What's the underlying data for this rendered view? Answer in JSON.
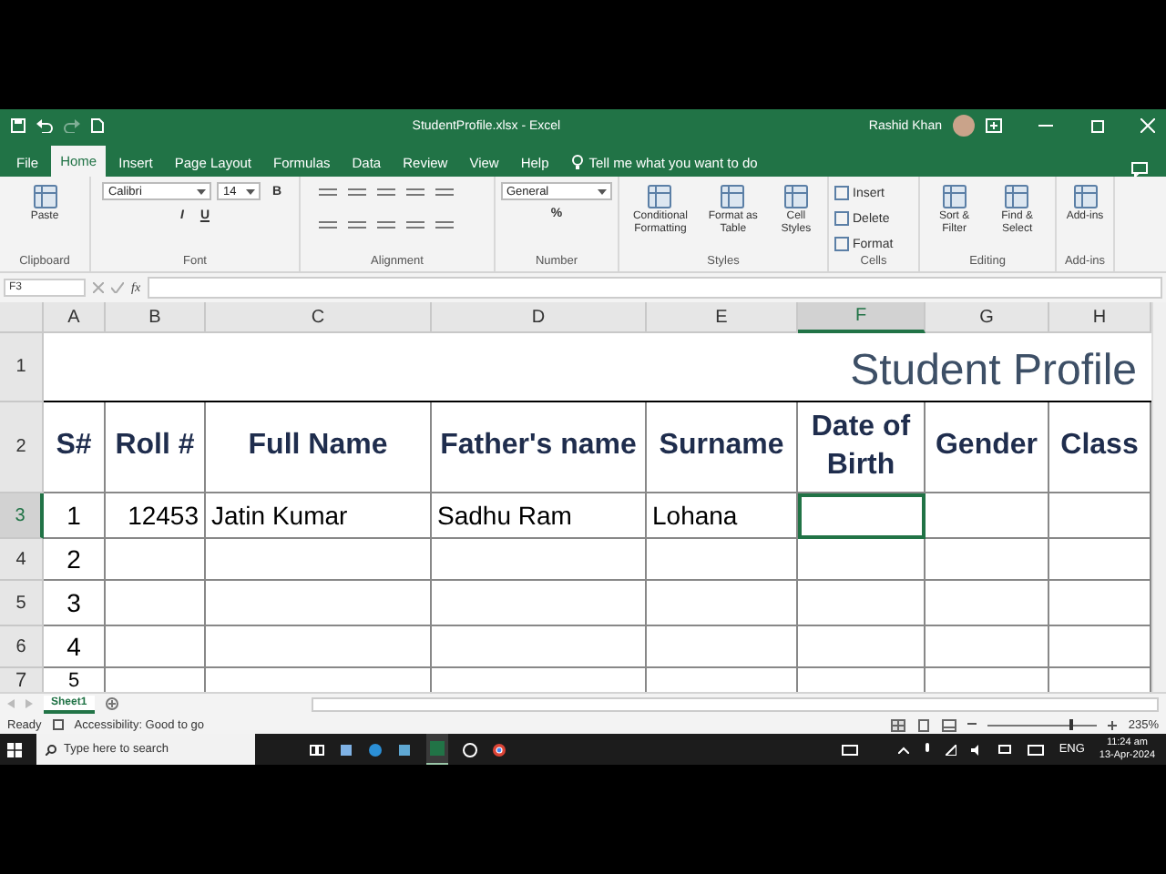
{
  "window": {
    "title": "StudentProfile.xlsx  -  Excel",
    "user": "Rashid Khan"
  },
  "tabs": [
    {
      "label": "File",
      "selected": false
    },
    {
      "label": "Home",
      "selected": true
    },
    {
      "label": "Insert",
      "selected": false
    },
    {
      "label": "Page Layout",
      "selected": false
    },
    {
      "label": "Formulas",
      "selected": false
    },
    {
      "label": "Data",
      "selected": false
    },
    {
      "label": "Review",
      "selected": false
    },
    {
      "label": "View",
      "selected": false
    },
    {
      "label": "Help",
      "selected": false
    }
  ],
  "tell_me": "Tell me what you want to do",
  "ribbon": [
    {
      "label": "Clipboard",
      "controls": [
        {
          "kind": "large",
          "label": "Paste"
        }
      ]
    },
    {
      "label": "Font",
      "controls": [
        {
          "kind": "dropdown",
          "value": "Calibri"
        },
        {
          "kind": "dropdown",
          "value": "14"
        },
        {
          "kind": "bold",
          "label": "B"
        },
        {
          "kind": "italic",
          "label": "I"
        },
        {
          "kind": "underline",
          "label": "U"
        }
      ]
    },
    {
      "label": "Alignment"
    },
    {
      "label": "Number",
      "controls": [
        {
          "kind": "dropdown",
          "value": "General"
        },
        {
          "kind": "percent",
          "label": "%"
        }
      ]
    },
    {
      "label": "Styles",
      "controls": [
        {
          "kind": "large",
          "label": "Conditional Formatting"
        },
        {
          "kind": "large",
          "label": "Format as Table"
        },
        {
          "kind": "large",
          "label": "Cell Styles"
        }
      ]
    },
    {
      "label": "Cells",
      "controls": [
        {
          "kind": "small",
          "label": "Insert"
        },
        {
          "kind": "small",
          "label": "Delete"
        },
        {
          "kind": "small",
          "label": "Format"
        }
      ]
    },
    {
      "label": "Editing",
      "controls": [
        {
          "kind": "large",
          "label": "Sort & Filter"
        },
        {
          "kind": "large",
          "label": "Find & Select"
        }
      ]
    },
    {
      "label": "Add-ins",
      "controls": [
        {
          "kind": "large",
          "label": "Add-ins"
        }
      ]
    }
  ],
  "formula_bar": {
    "function_label": "fx"
  },
  "sheet": {
    "columns": [
      {
        "label": "A",
        "selected": false
      },
      {
        "label": "B",
        "selected": false
      },
      {
        "label": "C",
        "selected": false
      },
      {
        "label": "D",
        "selected": false
      },
      {
        "label": "E",
        "selected": false
      },
      {
        "label": "F",
        "selected": true
      },
      {
        "label": "G",
        "selected": false
      },
      {
        "label": "H",
        "selected": false
      }
    ],
    "rows": [
      {
        "label": "1",
        "selected": false,
        "kind": "title",
        "title": "Student Profile"
      },
      {
        "label": "2",
        "selected": false,
        "kind": "header",
        "cells": {
          "A": "S#",
          "B": "Roll #",
          "C": "Full Name",
          "D": "Father's name",
          "E": "Surname",
          "F": "Date of Birth",
          "G": "Gender",
          "H": "Class"
        }
      },
      {
        "label": "3",
        "selected": true,
        "kind": "data",
        "cells": {
          "A": "1",
          "B": "12453",
          "C": "Jatin Kumar",
          "D": "Sadhu Ram",
          "E": "Lohana"
        }
      },
      {
        "label": "4",
        "selected": false,
        "kind": "data",
        "cells": {
          "A": "2"
        }
      },
      {
        "label": "5",
        "selected": false,
        "kind": "data",
        "cells": {
          "A": "3"
        }
      },
      {
        "label": "6",
        "selected": false,
        "kind": "data",
        "cells": {
          "A": "4"
        }
      },
      {
        "label": "7",
        "selected": false,
        "kind": "data",
        "cells": {
          "A": "5"
        }
      }
    ],
    "active_cell": "F3",
    "sheet_tabs": [
      {
        "label": "Sheet1",
        "selected": true
      }
    ]
  },
  "status_bar": {
    "mode": "Ready",
    "accessibility": "Accessibility: Good to go",
    "zoom": "235%",
    "zoom_slider": {
      "level": 0.75
    }
  },
  "taskbar": {
    "search_placeholder": "Type here to search",
    "language": "ENG",
    "time": "11:24 am",
    "date": "13-Apr-2024"
  }
}
